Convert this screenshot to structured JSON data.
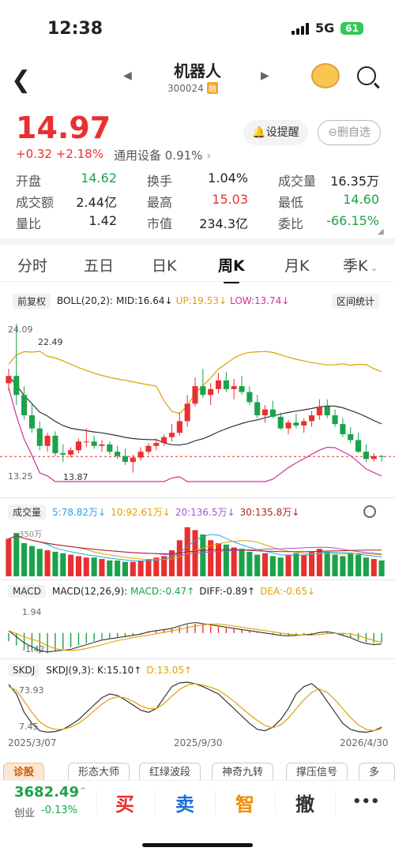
{
  "status": {
    "time": "12:38",
    "network": "5G",
    "battery": "61"
  },
  "header": {
    "title": "机器人",
    "code": "300024",
    "margin_badge": "融"
  },
  "quote": {
    "price": "14.97",
    "change": "+0.32",
    "change_pct": "+2.18%",
    "sector": "通用设备 0.91%",
    "alert_button": "设提醒",
    "remove_button": "删自选",
    "rows": [
      [
        {
          "label": "开盘",
          "value": "14.62"
        },
        {
          "label": "换手",
          "value": "1.04%"
        },
        {
          "label": "成交量",
          "value": "16.35万"
        }
      ],
      [
        {
          "label": "成交额",
          "value": "2.44亿"
        },
        {
          "label": "最高",
          "value": "15.03"
        },
        {
          "label": "最低",
          "value": "14.60"
        }
      ],
      [
        {
          "label": "量比",
          "value": "1.42"
        },
        {
          "label": "市值",
          "value": "234.3亿"
        },
        {
          "label": "委比",
          "value": "-66.15%"
        }
      ]
    ]
  },
  "tabs": [
    "分时",
    "五日",
    "日K",
    "周K",
    "月K",
    "季K"
  ],
  "active_tab": "周K",
  "boll": {
    "adjust": "前复权",
    "label": "BOLL(20,2):",
    "mid": "MID:16.64↓",
    "up": "UP:19.53↓",
    "low": "LOW:13.74↓",
    "stats_button": "区间统计"
  },
  "price_labels": {
    "high": "24.09",
    "high_mark": "22.49",
    "low": "13.25",
    "low_mark": "13.87"
  },
  "volume": {
    "label": "成交量",
    "ma5": "5:78.82万↓",
    "ma10": "10:92.61万↓",
    "ma20": "20:136.5万↓",
    "ma30": "30:135.8万↓",
    "axis": "350万"
  },
  "macd": {
    "name": "MACD",
    "label": "MACD(12,26,9):",
    "macd": "MACD:-0.47↑",
    "diff": "DIFF:-0.89↑",
    "dea": "DEA:-0.65↓",
    "top": "1.94",
    "bottom": "-1.42"
  },
  "skdj": {
    "name": "SKDJ",
    "label": "SKDJ(9,3):",
    "k": "K:15.10↑",
    "d": "D:13.05↑",
    "top": "73.93",
    "bottom": "7.45"
  },
  "dates": [
    "2025/3/07",
    "2025/9/30",
    "2026/4/30"
  ],
  "toolbar": [
    "诊股",
    "形态大师",
    "红绿波段",
    "神奇九转",
    "撑压信号",
    "多空线"
  ],
  "bottom": {
    "index_value": "3682.49",
    "index_name": "创业",
    "index_change": "-0.13%",
    "buy": "买",
    "sell": "卖",
    "smart": "智",
    "cancel": "撤",
    "more": "•••"
  },
  "colors": {
    "up": "#e93030",
    "down": "#1aa34a",
    "boll_up": "#e0a000",
    "boll_low": "#d0309d",
    "mid": "#333333",
    "ma5": "#29a3e0"
  },
  "chart_data": [
    {
      "type": "candlestick",
      "title": "周K",
      "ylim": [
        13.25,
        24.09
      ],
      "candles": [
        [
          20.0,
          21.0,
          19.5,
          20.5
        ],
        [
          20.5,
          24.09,
          18.5,
          19.2
        ],
        [
          19.2,
          19.8,
          17.5,
          17.8
        ],
        [
          17.8,
          18.6,
          16.6,
          16.9
        ],
        [
          16.9,
          17.4,
          15.4,
          15.7
        ],
        [
          15.7,
          16.6,
          15.3,
          16.4
        ],
        [
          16.4,
          16.7,
          15.0,
          15.2
        ],
        [
          15.2,
          15.8,
          14.6,
          15.1
        ],
        [
          15.1,
          15.6,
          14.9,
          15.4
        ],
        [
          15.4,
          16.2,
          15.2,
          16.0
        ],
        [
          16.0,
          16.9,
          15.6,
          16.0
        ],
        [
          16.0,
          16.4,
          15.5,
          15.7
        ],
        [
          15.7,
          16.1,
          15.3,
          15.8
        ],
        [
          15.8,
          16.0,
          15.1,
          15.3
        ],
        [
          15.3,
          15.7,
          14.8,
          15.0
        ],
        [
          15.0,
          15.5,
          14.4,
          14.6
        ],
        [
          14.6,
          15.1,
          13.87,
          14.9
        ],
        [
          14.9,
          15.6,
          14.7,
          15.3
        ],
        [
          15.3,
          15.9,
          15.1,
          15.7
        ],
        [
          15.7,
          16.2,
          15.4,
          15.9
        ],
        [
          15.9,
          16.5,
          15.7,
          16.3
        ],
        [
          16.3,
          17.2,
          16.0,
          16.6
        ],
        [
          16.6,
          18.0,
          16.4,
          17.4
        ],
        [
          17.4,
          19.2,
          17.0,
          18.6
        ],
        [
          18.6,
          20.4,
          18.4,
          19.8
        ],
        [
          19.8,
          21.0,
          19.0,
          19.2
        ],
        [
          19.2,
          20.0,
          18.5,
          19.6
        ],
        [
          19.6,
          20.7,
          19.3,
          20.2
        ],
        [
          20.2,
          20.8,
          19.4,
          19.6
        ],
        [
          19.6,
          20.3,
          18.9,
          19.8
        ],
        [
          19.8,
          20.5,
          19.2,
          19.4
        ],
        [
          19.4,
          19.8,
          18.5,
          18.7
        ],
        [
          18.7,
          19.2,
          17.6,
          17.8
        ],
        [
          17.8,
          18.5,
          17.3,
          18.2
        ],
        [
          18.2,
          18.8,
          17.6,
          17.7
        ],
        [
          17.7,
          18.0,
          16.8,
          16.9
        ],
        [
          16.9,
          17.5,
          16.5,
          17.3
        ],
        [
          17.3,
          17.9,
          16.9,
          17.1
        ],
        [
          17.1,
          17.6,
          16.6,
          17.4
        ],
        [
          17.4,
          18.1,
          17.0,
          17.8
        ],
        [
          17.8,
          18.9,
          17.5,
          18.4
        ],
        [
          18.4,
          18.9,
          17.6,
          17.8
        ],
        [
          17.8,
          18.2,
          17.0,
          17.2
        ],
        [
          17.2,
          17.6,
          16.3,
          16.5
        ],
        [
          16.5,
          17.0,
          15.9,
          16.1
        ],
        [
          16.1,
          16.6,
          15.2,
          15.3
        ],
        [
          15.3,
          15.8,
          14.6,
          14.8
        ],
        [
          14.8,
          15.2,
          14.6,
          15.0
        ],
        [
          15.0,
          15.1,
          14.6,
          14.97
        ]
      ]
    },
    {
      "type": "bar",
      "title": "成交量",
      "ylim": [
        0,
        350
      ],
      "values": [
        260,
        300,
        230,
        210,
        190,
        180,
        170,
        160,
        150,
        140,
        130,
        130,
        120,
        110,
        110,
        100,
        100,
        110,
        120,
        130,
        140,
        180,
        250,
        340,
        320,
        290,
        250,
        230,
        220,
        200,
        190,
        170,
        150,
        160,
        140,
        130,
        150,
        160,
        150,
        170,
        190,
        170,
        150,
        140,
        160,
        150,
        130,
        120,
        110
      ]
    },
    {
      "type": "bar",
      "title": "MACD",
      "ylim": [
        -1.42,
        1.94
      ],
      "values": [
        -0.4,
        -0.6,
        -0.8,
        -0.9,
        -1.0,
        -1.0,
        -0.9,
        -0.8,
        -0.7,
        -0.6,
        -0.5,
        -0.4,
        -0.3,
        -0.25,
        -0.2,
        -0.15,
        -0.1,
        -0.05,
        0.05,
        0.1,
        0.15,
        0.2,
        0.3,
        0.4,
        0.45,
        0.4,
        0.35,
        0.3,
        0.25,
        0.2,
        0.15,
        0.1,
        0.05,
        0.0,
        -0.05,
        -0.1,
        -0.12,
        -0.1,
        -0.08,
        -0.05,
        0.02,
        0.05,
        0.0,
        -0.1,
        -0.2,
        -0.35,
        -0.45,
        -0.5,
        -0.47
      ]
    },
    {
      "type": "line",
      "title": "SKDJ",
      "ylim": [
        7.45,
        73.93
      ],
      "series": [
        {
          "name": "K",
          "values": [
            73,
            60,
            35,
            20,
            10,
            8,
            9,
            12,
            18,
            25,
            35,
            45,
            55,
            60,
            58,
            52,
            45,
            38,
            35,
            40,
            55,
            70,
            75,
            76,
            74,
            70,
            65,
            60,
            50,
            40,
            30,
            20,
            12,
            10,
            15,
            25,
            40,
            60,
            70,
            74,
            65,
            50,
            35,
            20,
            12,
            9,
            8,
            10,
            15
          ]
        },
        {
          "name": "D",
          "values": [
            70,
            65,
            50,
            35,
            22,
            15,
            12,
            12,
            15,
            20,
            28,
            37,
            46,
            53,
            56,
            55,
            50,
            44,
            40,
            40,
            47,
            57,
            66,
            72,
            74,
            72,
            69,
            65,
            58,
            50,
            41,
            32,
            24,
            17,
            14,
            18,
            27,
            40,
            52,
            62,
            67,
            62,
            52,
            40,
            28,
            18,
            12,
            10,
            13
          ]
        }
      ]
    }
  ]
}
